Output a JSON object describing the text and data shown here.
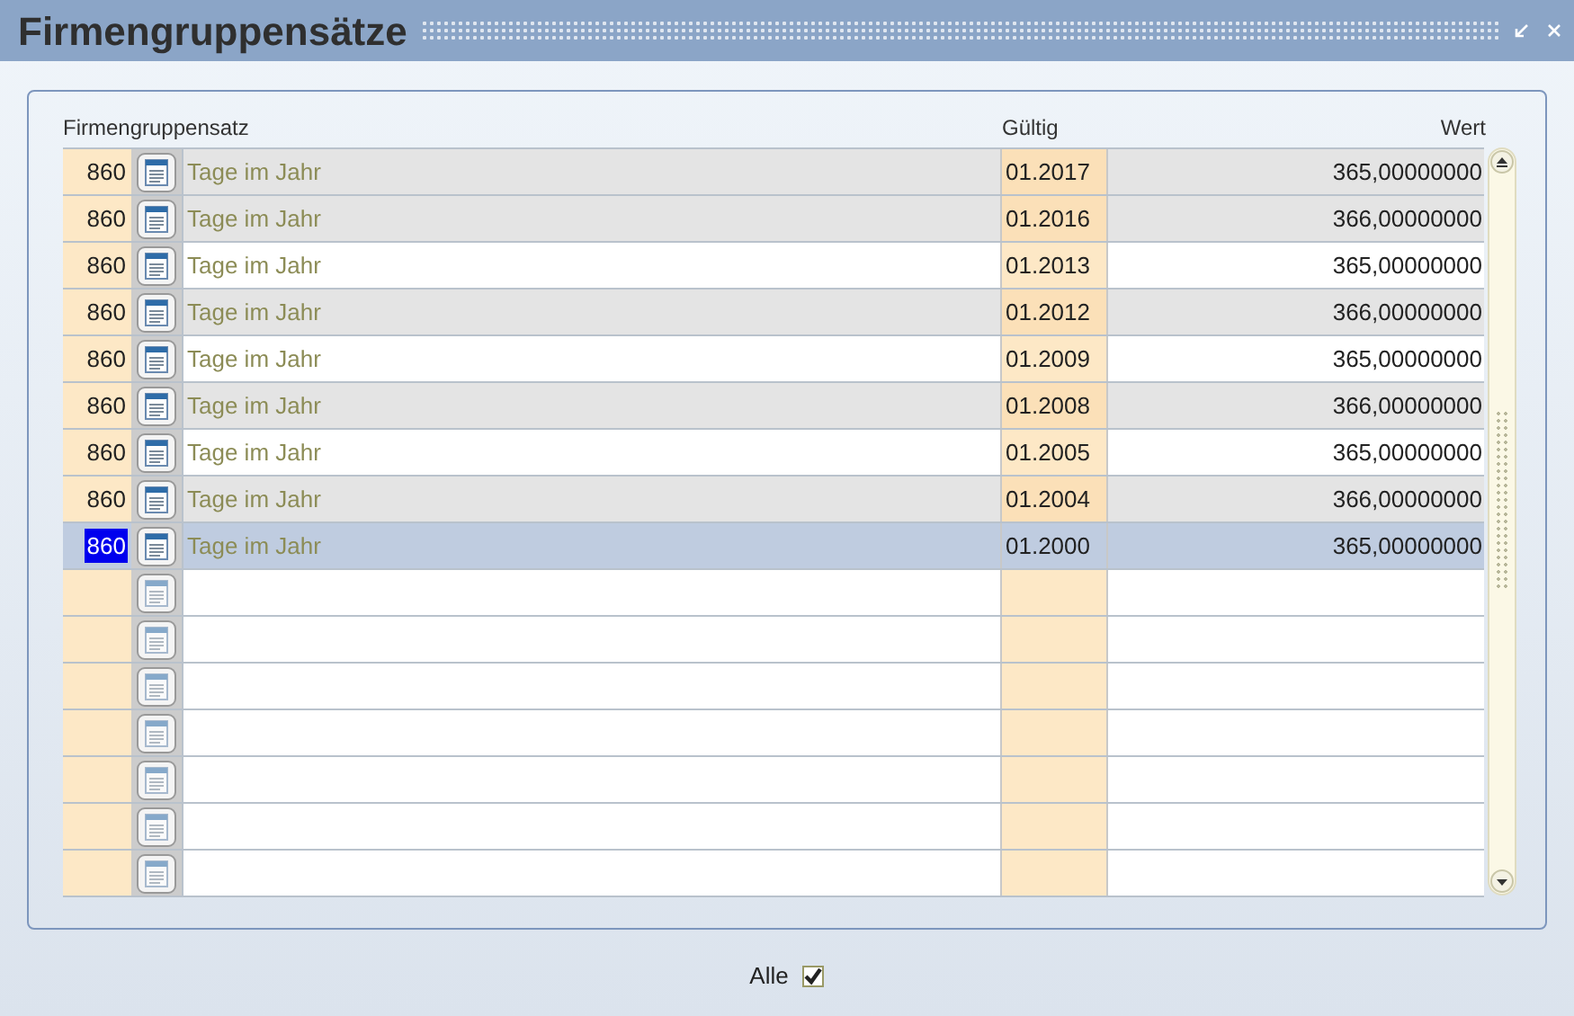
{
  "window": {
    "title": "Firmengruppensätze"
  },
  "table": {
    "columns": [
      "Firmengruppensatz",
      "Gültig",
      "Wert"
    ],
    "rows": [
      {
        "kind": "data",
        "number": "860",
        "name": "Tage im Jahr",
        "valid": "01.2017",
        "value": "365,00000000",
        "shaded": true,
        "selected": false
      },
      {
        "kind": "data",
        "number": "860",
        "name": "Tage im Jahr",
        "valid": "01.2016",
        "value": "366,00000000",
        "shaded": true,
        "selected": false
      },
      {
        "kind": "data",
        "number": "860",
        "name": "Tage im Jahr",
        "valid": "01.2013",
        "value": "365,00000000",
        "shaded": false,
        "selected": false
      },
      {
        "kind": "data",
        "number": "860",
        "name": "Tage im Jahr",
        "valid": "01.2012",
        "value": "366,00000000",
        "shaded": true,
        "selected": false
      },
      {
        "kind": "data",
        "number": "860",
        "name": "Tage im Jahr",
        "valid": "01.2009",
        "value": "365,00000000",
        "shaded": false,
        "selected": false
      },
      {
        "kind": "data",
        "number": "860",
        "name": "Tage im Jahr",
        "valid": "01.2008",
        "value": "366,00000000",
        "shaded": true,
        "selected": false
      },
      {
        "kind": "data",
        "number": "860",
        "name": "Tage im Jahr",
        "valid": "01.2005",
        "value": "365,00000000",
        "shaded": false,
        "selected": false
      },
      {
        "kind": "data",
        "number": "860",
        "name": "Tage im Jahr",
        "valid": "01.2004",
        "value": "366,00000000",
        "shaded": true,
        "selected": false
      },
      {
        "kind": "data",
        "number": "860",
        "name": "Tage im Jahr",
        "valid": "01.2000",
        "value": "365,00000000",
        "shaded": false,
        "selected": true
      },
      {
        "kind": "empty"
      },
      {
        "kind": "empty"
      },
      {
        "kind": "empty"
      },
      {
        "kind": "empty"
      },
      {
        "kind": "empty"
      },
      {
        "kind": "empty"
      },
      {
        "kind": "empty"
      }
    ]
  },
  "footer": {
    "label": "Alle",
    "checked": true
  }
}
